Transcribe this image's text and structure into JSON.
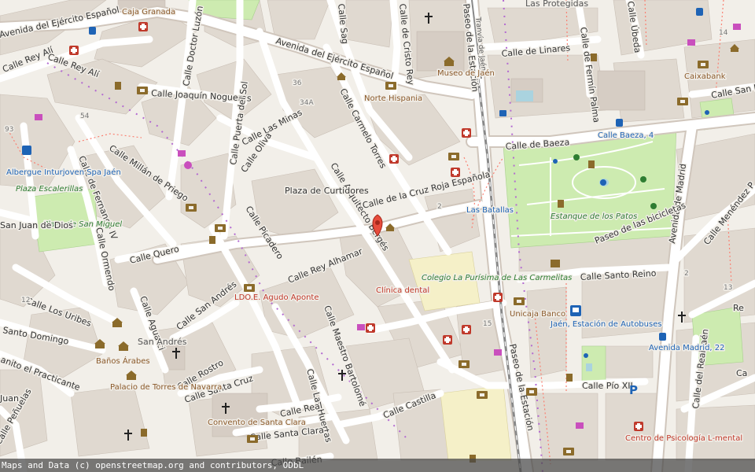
{
  "attribution": "Maps and Data (c) openstreetmap.org and contributors, ODbL",
  "colors": {
    "background": "#f2efe9",
    "road": "#ffffff",
    "park": "#cdebb0",
    "building": "#d9d0c9",
    "rail": "#999999",
    "marker": "#e74c3c",
    "footway": "#fa8072"
  },
  "streets": {
    "ejercito_esp_1": "Avenida del Ejército Español",
    "ejercito_esp_2": "Avenida del Ejército Español",
    "rey_ali_1": "Calle Rey Alí",
    "rey_ali_2": "Calle Rey Alí",
    "doctor_luzon": "Calle Doctor Luzón",
    "joaquin_nogueras": "Calle Joaquín Nogueras",
    "cristo_rey": "Calle de Cristo Rey",
    "sagunto": "Calle Sag",
    "carmelo_torres": "Calle Carmelo Torres",
    "estacion_paseo": "Paseo de la Estación",
    "tranvia": "Tranvía de Jaén",
    "linares": "Calle de Linares",
    "fermin_palma": "Calle de Fermín Palma",
    "ubeda": "Calle Úbeda",
    "san_ra": "Calle San R",
    "baeza": "Calle de Baeza",
    "puerta_sol": "Calle Puerta del Sol",
    "las_minas": "Calle Las Minas",
    "oliva": "Calle Oliva",
    "millan_priego": "Calle Millán de Priego",
    "fernando_iv": "Calle de Fernando IV",
    "arquitecto_berges": "Calle Arquitecto Bergés",
    "cruz_roja": "Calle de la Cruz Roja Española",
    "plaza_curtidores": "Plaza de Curtidores",
    "picadero": "Calle Picadero",
    "quero": "Calle Quero",
    "ormendo": "Calle Ormendo",
    "rey_alhamar": "Calle Rey Alhamar",
    "los_uribes": "Calle Los Uribes",
    "santo_domingo": "Santo Domingo",
    "aguatci": "Calle Aguatci",
    "san_andres": "Calle San Andrés",
    "practicante": "anito el Practicante",
    "rostro": "Calle Rostro",
    "santa_cruz": "Calle Santa Cruz",
    "maestro_bartolome": "Calle Maestro Bartolomé",
    "las_huertas": "Calle Las Huertas",
    "real": "Calle Real",
    "santa_clara": "Calle Santa Clara",
    "castilla": "Calle Castilla",
    "bailen": "Calle Bailén",
    "penuelas": "Calle Peñuelas",
    "juan": "Juan",
    "pio_xii": "Calle Pío XII",
    "santo_reino": "Calle Santo Reino",
    "estacion_paseo_2": "Paseo de la Estación",
    "madrid_av": "Avenida de Madrid",
    "real_jaen": "Calle del Real Jaén",
    "menendez": "Calle Menéndez P",
    "bicicletas": "Paseo de las bicicletas",
    "las_protegidas": "Las Protegidas",
    "ca": "Ca",
    "re": "Re"
  },
  "places": {
    "caja_granada": "Caja Granada",
    "museo_jaen": "Museo de Jaén",
    "norte_hispania": "Norte Hispania",
    "caixabank": "Caixabank",
    "calle_baeza_4": "Calle Baeza, 4",
    "las_batallas": "Las Batallas",
    "estanque": "Estanque de los Patos",
    "albergue": "Albergue Inturjoven Spa Jaén",
    "plaza_escalerillas": "Plaza Escalerillas",
    "plaza_san_miguel": "Plaza de San Miguel",
    "san_juan": "San Juan de Dios",
    "colegio": "Colegio La Purísima de Las Carmelitas",
    "clinica": "Clínica dental",
    "ldo_aguado": "LDO.E. Agudo Aponte",
    "unicaja": "Unicaja Banco",
    "estacion_bus": "Jaén, Estación de Autobuses",
    "av_madrid_22": "Avenida Madrid, 22",
    "san_andres_pl": "San Andrés",
    "banos_arabes": "Baños Árabes",
    "palacio": "Palacio de Torres de Navarra",
    "convento": "Convento de Santa Clara",
    "centro_psico": "Centro de Psicología L-mental"
  },
  "numbers": {
    "n93": "93",
    "n54": "54",
    "n36": "36",
    "n34a": "34A",
    "n2": "2",
    "n15": "15",
    "n12": "12",
    "n14": "14",
    "n13": "13",
    "n2b": "2"
  },
  "icons": [
    "bank-icon",
    "pharmacy-icon",
    "bus-stop-icon",
    "church-icon",
    "museum-icon",
    "courthouse-icon",
    "parking-icon",
    "restaurant-icon",
    "shop-icon",
    "fountain-icon",
    "playground-icon",
    "library-icon",
    "location-marker-icon"
  ]
}
